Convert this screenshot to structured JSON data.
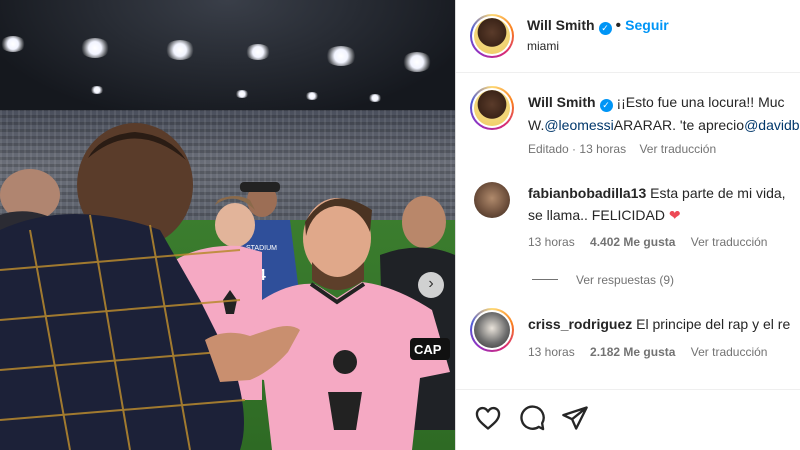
{
  "post": {
    "author": {
      "username": "Will Smith",
      "verified_icon": "verified-check-icon",
      "follow_label": "Seguir",
      "location": "miami"
    },
    "caption": {
      "username": "Will Smith",
      "text_start": "¡¡Esto fue una locura!! Muc",
      "line2_prefix": "W.",
      "mention1": "@leomessi",
      "line2_mid": "ARARAR. 'te aprecio",
      "mention2": "@davidb",
      "edited_label": "Editado",
      "time": "13 horas",
      "translate_label": "Ver traducción"
    },
    "comments": [
      {
        "username": "fabianbobadilla13",
        "text_line1": "Esta parte de mi vida,",
        "text_line2": "se llama.. FELICIDAD",
        "emoji": "❤",
        "time": "13 horas",
        "likes": "4.402 Me gusta",
        "translate_label": "Ver traducción",
        "replies_label": "Ver respuestas (9)"
      },
      {
        "username": "criss_rodriguez",
        "text_line1": "El principe del rap y el re",
        "time": "13 horas",
        "likes": "2.182 Me gusta",
        "translate_label": "Ver traducción"
      }
    ],
    "actions": [
      "like-heart-icon",
      "comment-bubble-icon",
      "share-plane-icon"
    ],
    "photo": {
      "next_icon": "chevron-right-icon",
      "jersey_number": "24",
      "captain_band": "CAP",
      "sign_text": "STADIUM"
    }
  },
  "colors": {
    "accent": "#0095f6",
    "link": "#00376b",
    "heart": "#ed4956",
    "jersey_pink": "#f5a9c3"
  }
}
